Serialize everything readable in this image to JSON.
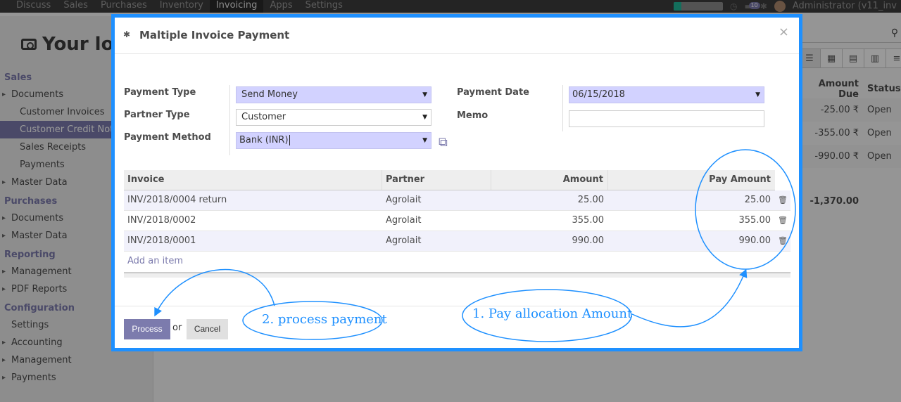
{
  "topbar": {
    "menu": [
      "Discuss",
      "Sales",
      "Purchases",
      "Inventory",
      "Invoicing",
      "Apps",
      "Settings"
    ],
    "active_menu": "Invoicing",
    "progress_fraction": 0.15,
    "chat_count": "10",
    "user": "Administrator (v11_inv"
  },
  "sidebar": {
    "logo_text": "Your log",
    "sections": [
      {
        "title": "Sales",
        "items": [
          {
            "label": "Documents",
            "type": "caret"
          },
          {
            "label": "Customer Invoices",
            "type": "sub"
          },
          {
            "label": "Customer Credit Notes",
            "type": "sub",
            "selected": true
          },
          {
            "label": "Sales Receipts",
            "type": "sub"
          },
          {
            "label": "Payments",
            "type": "sub"
          },
          {
            "label": "Master Data",
            "type": "caret"
          }
        ]
      },
      {
        "title": "Purchases",
        "items": [
          {
            "label": "Documents",
            "type": "caret"
          },
          {
            "label": "Master Data",
            "type": "caret"
          }
        ]
      },
      {
        "title": "Reporting",
        "items": [
          {
            "label": "Management",
            "type": "caret"
          },
          {
            "label": "PDF Reports",
            "type": "caret"
          }
        ]
      },
      {
        "title": "Configuration",
        "items": [
          {
            "label": "Settings",
            "type": "plain"
          },
          {
            "label": "Accounting",
            "type": "caret"
          },
          {
            "label": "Management",
            "type": "caret"
          },
          {
            "label": "Payments",
            "type": "caret"
          }
        ]
      }
    ]
  },
  "background_table": {
    "headers": {
      "amount_due": "Amount Due",
      "status": "Status"
    },
    "rows": [
      {
        "amount_due": "-25.00 ₹",
        "status": "Open"
      },
      {
        "amount_due": "-355.00 ₹",
        "status": "Open"
      },
      {
        "amount_due": "-990.00 ₹",
        "status": "Open"
      }
    ],
    "total": "-1,370.00"
  },
  "modal": {
    "title": "Maltiple Invoice Payment",
    "close": "×",
    "fields": {
      "payment_type_label": "Payment Type",
      "payment_type_value": "Send Money",
      "partner_type_label": "Partner Type",
      "partner_type_value": "Customer",
      "payment_method_label": "Payment Method",
      "payment_method_value": "Bank (INR)",
      "payment_date_label": "Payment Date",
      "payment_date_value": "06/15/2018",
      "memo_label": "Memo",
      "memo_value": ""
    },
    "table": {
      "headers": {
        "invoice": "Invoice",
        "partner": "Partner",
        "amount": "Amount",
        "pay_amount": "Pay Amount"
      },
      "rows": [
        {
          "invoice": "INV/2018/0004 return",
          "partner": "Agrolait",
          "amount": "25.00",
          "pay_amount": "25.00"
        },
        {
          "invoice": "INV/2018/0002",
          "partner": "Agrolait",
          "amount": "355.00",
          "pay_amount": "355.00"
        },
        {
          "invoice": "INV/2018/0001",
          "partner": "Agrolait",
          "amount": "990.00",
          "pay_amount": "990.00"
        }
      ],
      "add_item": "Add an item"
    },
    "footer": {
      "process": "Process",
      "or": "or",
      "cancel": "Cancel"
    }
  },
  "annotations": {
    "process_note": "2. process payment",
    "allocation_note": "1. Pay allocation Amount",
    "color": "#1e90ff"
  }
}
